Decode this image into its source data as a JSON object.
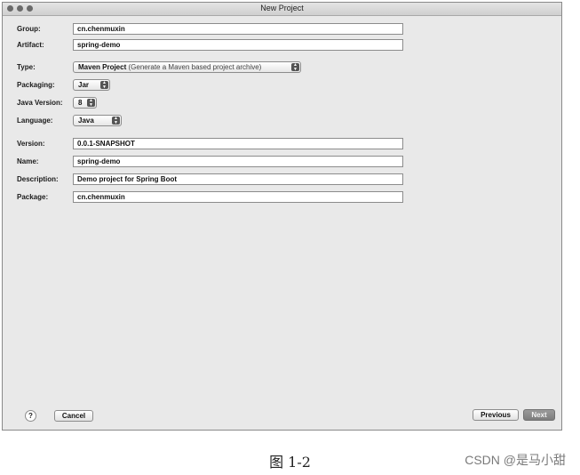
{
  "window": {
    "title": "New Project"
  },
  "form": {
    "group": {
      "label": "Group:",
      "value": "cn.chenmuxin"
    },
    "artifact": {
      "label": "Artifact:",
      "value": "spring-demo"
    },
    "type": {
      "label": "Type:",
      "value": "Maven Project",
      "hint": "(Generate a Maven based project archive)"
    },
    "packaging": {
      "label": "Packaging:",
      "value": "Jar"
    },
    "java_version": {
      "label": "Java Version:",
      "value": "8"
    },
    "language": {
      "label": "Language:",
      "value": "Java"
    },
    "version": {
      "label": "Version:",
      "value": "0.0.1-SNAPSHOT"
    },
    "name": {
      "label": "Name:",
      "value": "spring-demo"
    },
    "description": {
      "label": "Description:",
      "value": "Demo project for Spring Boot"
    },
    "package": {
      "label": "Package:",
      "value": "cn.chenmuxin"
    }
  },
  "footer": {
    "help_label": "?",
    "cancel_label": "Cancel",
    "previous_label": "Previous",
    "next_label": "Next"
  },
  "caption": "图 1-2",
  "watermark": "CSDN @是马小甜",
  "icons": {
    "stepper": "up-down-arrows-icon",
    "window_controls": "traffic-light-icons"
  }
}
